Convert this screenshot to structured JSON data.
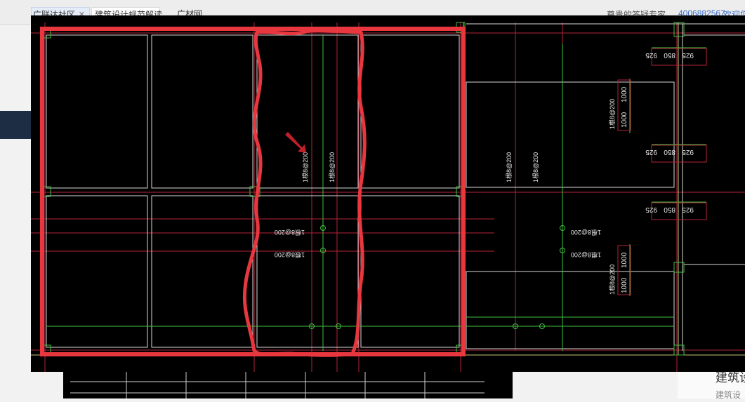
{
  "tabs": [
    {
      "label": "广联达社区"
    },
    {
      "label": "建筑设计规范解读..."
    },
    {
      "label": "广材网"
    }
  ],
  "header": {
    "expert_text": "尊贵的答疑专家",
    "phone_text": "4006882567",
    "welcome_text": "欢迎您"
  },
  "page": {
    "title": "建筑设",
    "subtitle": "建筑设"
  },
  "cad": {
    "colors": {
      "background": "#000000",
      "grid_red": "#b3243a",
      "rebar_green": "#3fbf3f",
      "beam_white": "#d8d8d8",
      "markup_red": "#e8373f",
      "arrow_red": "#c0202a"
    },
    "rebar_labels": [
      {
        "text": "1根8@200"
      },
      {
        "text": "1根8@200"
      },
      {
        "text": "1根8@200"
      },
      {
        "text": "1根8@200"
      },
      {
        "text": "1根8@200"
      },
      {
        "text": "1根8@200"
      },
      {
        "text": "1根8@200"
      },
      {
        "text": "1根8@200"
      },
      {
        "text": "1根8@200"
      },
      {
        "text": "1根8@200"
      }
    ],
    "dim_labels": [
      {
        "text": "925"
      },
      {
        "text": "850"
      },
      {
        "text": "925"
      },
      {
        "text": "925"
      },
      {
        "text": "850"
      },
      {
        "text": "925"
      },
      {
        "text": "925"
      },
      {
        "text": "850"
      },
      {
        "text": "925"
      },
      {
        "text": "1000"
      },
      {
        "text": "1000"
      },
      {
        "text": "1000"
      },
      {
        "text": "1000"
      }
    ]
  }
}
